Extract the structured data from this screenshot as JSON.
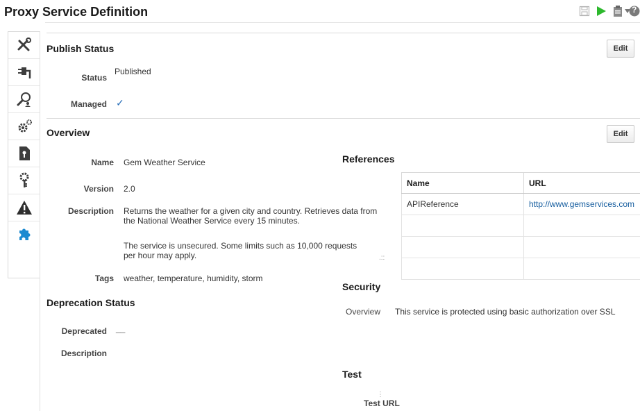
{
  "header": {
    "title": "Proxy Service Definition",
    "icons": [
      "save-icon",
      "run-icon",
      "clipboard-icon",
      "dropdown-icon",
      "help-icon"
    ],
    "help_glyph": "?"
  },
  "sidebar": {
    "items": [
      {
        "name": "tools",
        "icon": "tools-icon"
      },
      {
        "name": "transport",
        "icon": "plug-icon"
      },
      {
        "name": "search",
        "icon": "search-person-icon"
      },
      {
        "name": "policies",
        "icon": "gears-icon"
      },
      {
        "name": "security",
        "icon": "keyhole-document-icon"
      },
      {
        "name": "keys",
        "icon": "gear-key-icon"
      },
      {
        "name": "alerts",
        "icon": "warning-icon"
      },
      {
        "name": "extensions",
        "icon": "puzzle-icon",
        "active": true
      }
    ]
  },
  "publish_status": {
    "title": "Publish Status",
    "edit_label": "Edit",
    "status_label": "Status",
    "status_value": "Published",
    "managed_label": "Managed",
    "managed_value": "✓"
  },
  "overview": {
    "title": "Overview",
    "edit_label": "Edit",
    "name_label": "Name",
    "name_value": "Gem Weather Service",
    "version_label": "Version",
    "version_value": "2.0",
    "description_label": "Description",
    "description_p1": "Returns the weather for a given city and country. Retrieves data from the National Weather Service every 15 minutes.",
    "description_p2": "The service is unsecured. Some limits such as 10,000 requests per hour may apply.",
    "tags_label": "Tags",
    "tags_value": "weather, temperature, humidity, storm"
  },
  "deprecation": {
    "title": "Deprecation Status",
    "deprecated_label": "Deprecated",
    "deprecated_value": "__",
    "description_label": "Description"
  },
  "references": {
    "title": "References",
    "columns": [
      "Name",
      "URL"
    ],
    "rows": [
      {
        "name": "APIReference",
        "url": "http://www.gemservices.com"
      }
    ]
  },
  "security": {
    "title": "Security",
    "overview_label": "Overview",
    "overview_value": "This service is protected using basic authorization over SSL"
  },
  "test": {
    "title": "Test",
    "url_label": "Test URL"
  },
  "colors": {
    "run_green": "#2db82d",
    "link_blue": "#145c9e",
    "puzzle_blue": "#1c8ad1",
    "check_blue": "#2a6fb8"
  }
}
